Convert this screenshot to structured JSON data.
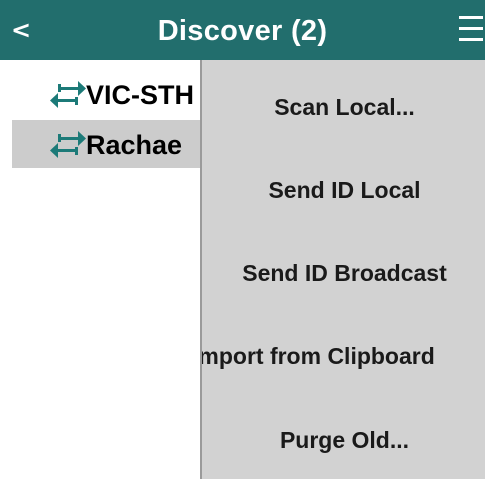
{
  "header": {
    "back_label": "<",
    "title": "Discover (2)",
    "menu_icon": "hamburger-icon",
    "background_color": "#226e6d"
  },
  "list": {
    "items": [
      {
        "label": "VIC-STH",
        "icon": "swap-arrows-icon",
        "selected": false
      },
      {
        "label": "Rachae",
        "icon": "swap-arrows-icon",
        "selected": true
      }
    ],
    "icon_color": "#1c7a78"
  },
  "dropdown_menu": {
    "items": [
      {
        "label": "Scan Local..."
      },
      {
        "label": "Send ID Local"
      },
      {
        "label": "Send ID Broadcast"
      },
      {
        "label": "Import from Clipboard"
      },
      {
        "label": "Purge Old..."
      }
    ]
  }
}
